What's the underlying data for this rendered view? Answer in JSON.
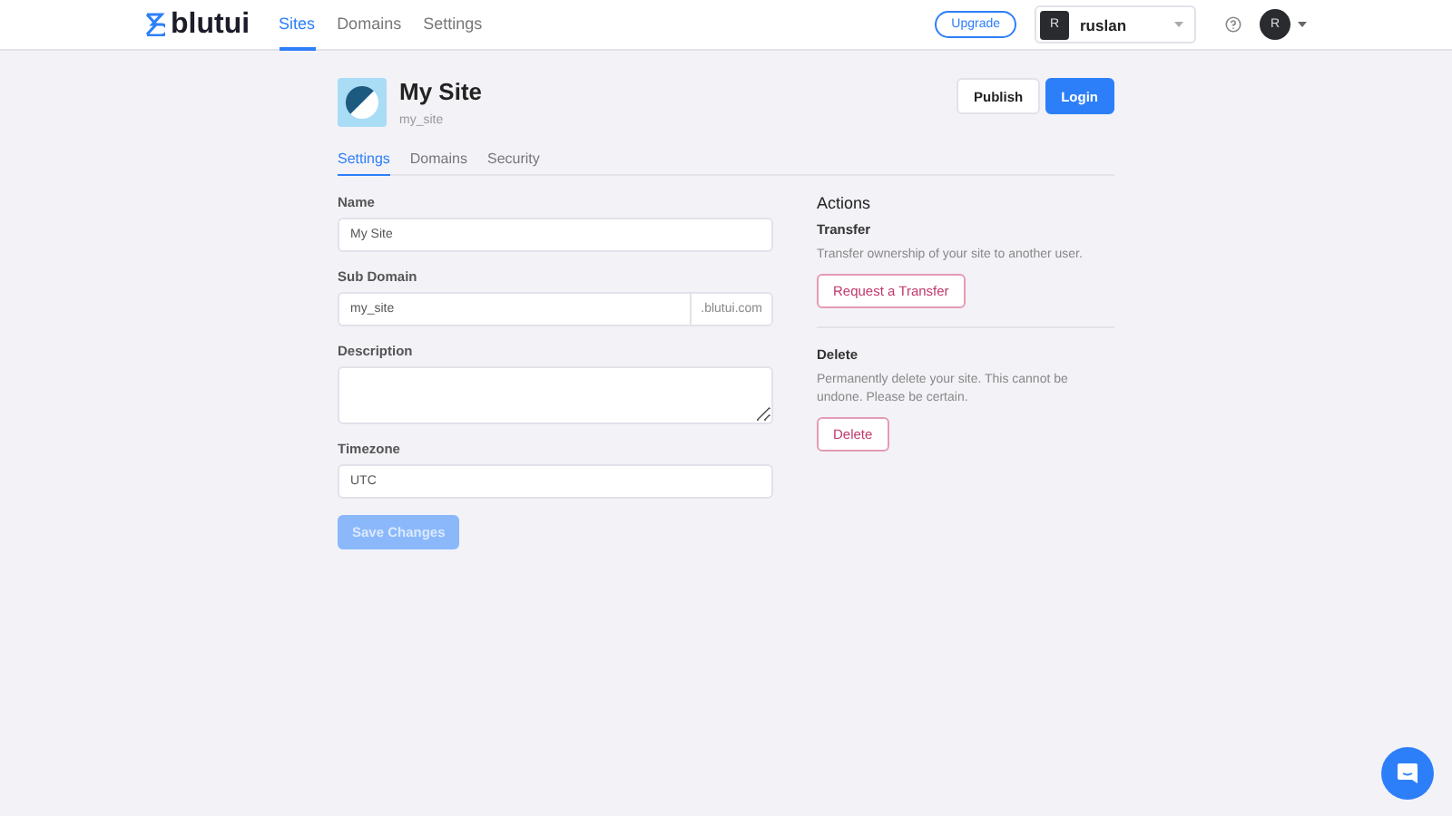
{
  "header": {
    "brand": "blutui",
    "nav": [
      {
        "label": "Sites",
        "selected": true
      },
      {
        "label": "Domains",
        "selected": false
      },
      {
        "label": "Settings",
        "selected": false
      }
    ],
    "upgrade": "Upgrade",
    "account": {
      "initial": "R",
      "name": "ruslan"
    },
    "avatar": "R"
  },
  "site": {
    "name": "My Site",
    "handle": "my_site",
    "buttons": [
      {
        "label": "Publish",
        "kind": "secondary"
      },
      {
        "label": "Login",
        "kind": "primary"
      }
    ]
  },
  "tabs": [
    {
      "label": "Settings",
      "selected": true
    },
    {
      "label": "Domains",
      "selected": false
    },
    {
      "label": "Security",
      "selected": false
    }
  ],
  "form": {
    "fields": [
      {
        "label": "Name",
        "kind": "text",
        "value": "My Site"
      },
      {
        "label": "Sub Domain",
        "kind": "suffix",
        "value": "my_site",
        "suffix": ".blutui.com"
      },
      {
        "label": "Description",
        "kind": "textarea"
      },
      {
        "label": "Timezone",
        "kind": "text",
        "value": "UTC"
      }
    ],
    "save": {
      "label": "Save Changes",
      "disabled": true
    }
  },
  "actions": {
    "title": "Actions",
    "sections": [
      {
        "title": "Transfer",
        "text": "Transfer ownership of your site to another user.",
        "button": "Request a Transfer"
      },
      {
        "title": "Delete",
        "text": "Permanently delete your site. This cannot be undone. Please be certain.",
        "button": "Delete"
      }
    ]
  }
}
